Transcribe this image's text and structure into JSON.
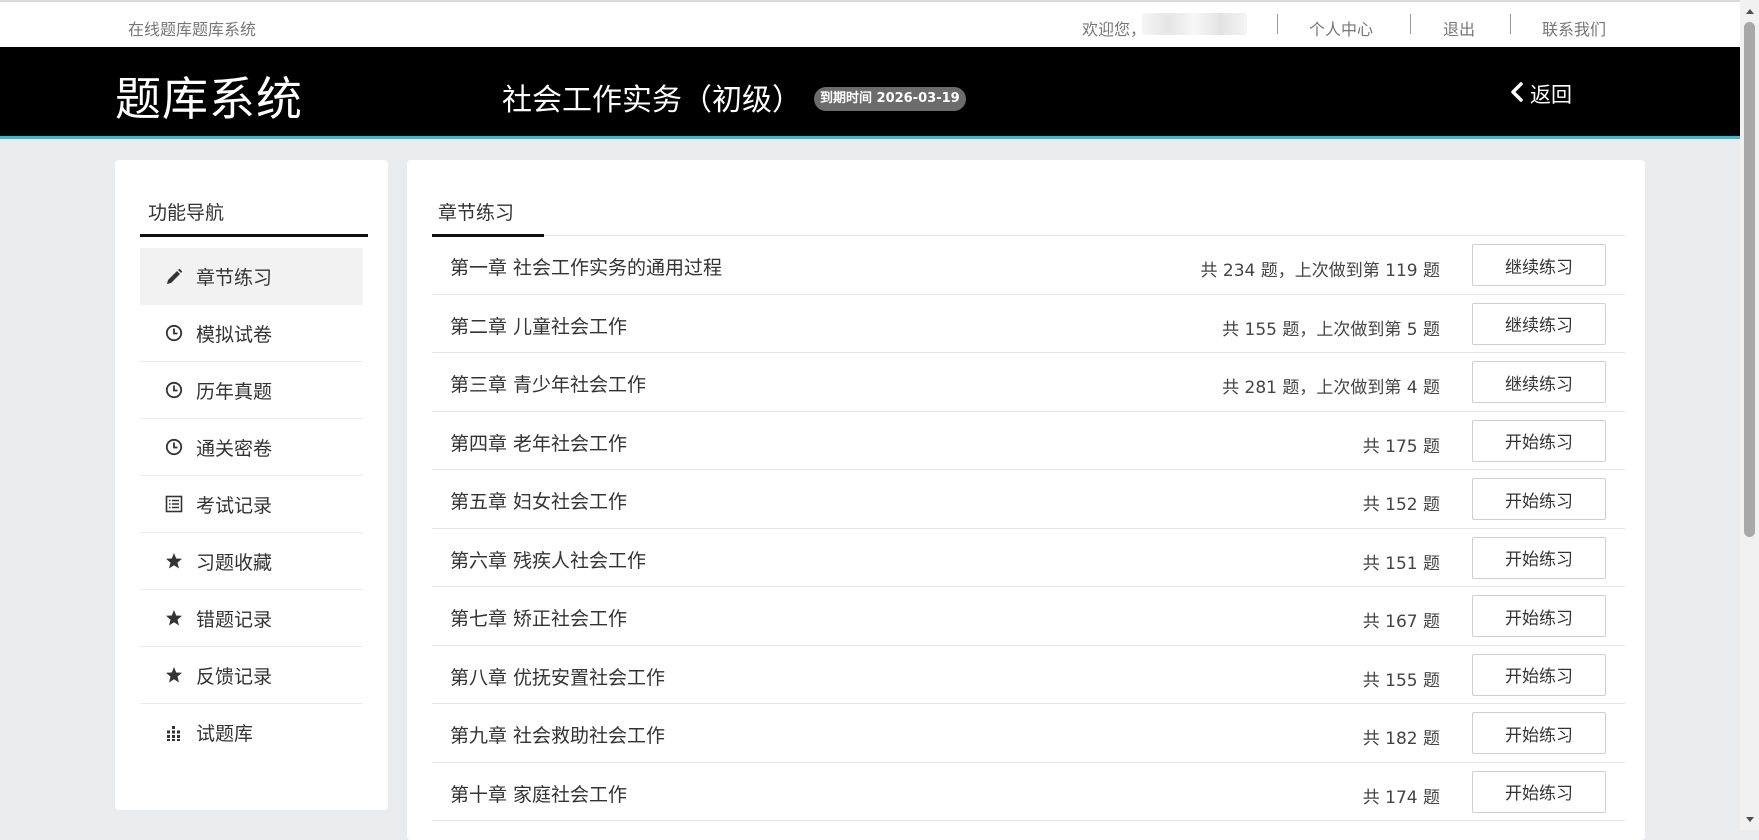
{
  "topbar": {
    "site_name": "在线题库题库系统",
    "welcome": "欢迎您，",
    "links": [
      "个人中心",
      "退出",
      "联系我们"
    ]
  },
  "header": {
    "logo": "题库系统",
    "course_title": "社会工作实务（初级）",
    "expire_badge": "到期时间 2026-03-19",
    "back_label": "返回"
  },
  "sidebar": {
    "title": "功能导航",
    "items": [
      {
        "label": "章节练习",
        "icon": "pencil-icon",
        "active": true
      },
      {
        "label": "模拟试卷",
        "icon": "clock-icon"
      },
      {
        "label": "历年真题",
        "icon": "clock-icon"
      },
      {
        "label": "通关密卷",
        "icon": "clock-icon"
      },
      {
        "label": "考试记录",
        "icon": "list-icon"
      },
      {
        "label": "习题收藏",
        "icon": "star-icon"
      },
      {
        "label": "错题记录",
        "icon": "star-icon"
      },
      {
        "label": "反馈记录",
        "icon": "star-icon"
      },
      {
        "label": "试题库",
        "icon": "grid-icon"
      }
    ]
  },
  "main": {
    "tab_title": "章节练习",
    "chapters": [
      {
        "name": "第一章 社会工作实务的通用过程",
        "info": "共 234 题，上次做到第 119 题",
        "button": "继续练习"
      },
      {
        "name": "第二章 儿童社会工作",
        "info": "共 155 题，上次做到第 5 题",
        "button": "继续练习"
      },
      {
        "name": "第三章 青少年社会工作",
        "info": "共 281 题，上次做到第 4 题",
        "button": "继续练习"
      },
      {
        "name": "第四章 老年社会工作",
        "info": "共 175 题",
        "button": "开始练习"
      },
      {
        "name": "第五章 妇女社会工作",
        "info": "共 152 题",
        "button": "开始练习"
      },
      {
        "name": "第六章 残疾人社会工作",
        "info": "共 151 题",
        "button": "开始练习"
      },
      {
        "name": "第七章 矫正社会工作",
        "info": "共 167 题",
        "button": "开始练习"
      },
      {
        "name": "第八章 优抚安置社会工作",
        "info": "共 155 题",
        "button": "开始练习"
      },
      {
        "name": "第九章 社会救助社会工作",
        "info": "共 182 题",
        "button": "开始练习"
      },
      {
        "name": "第十章 家庭社会工作",
        "info": "共 174 题",
        "button": "开始练习"
      }
    ]
  },
  "colors": {
    "header_bg": "#000000",
    "accent_line": "#2cc0d8",
    "page_bg": "#e9ecef"
  }
}
